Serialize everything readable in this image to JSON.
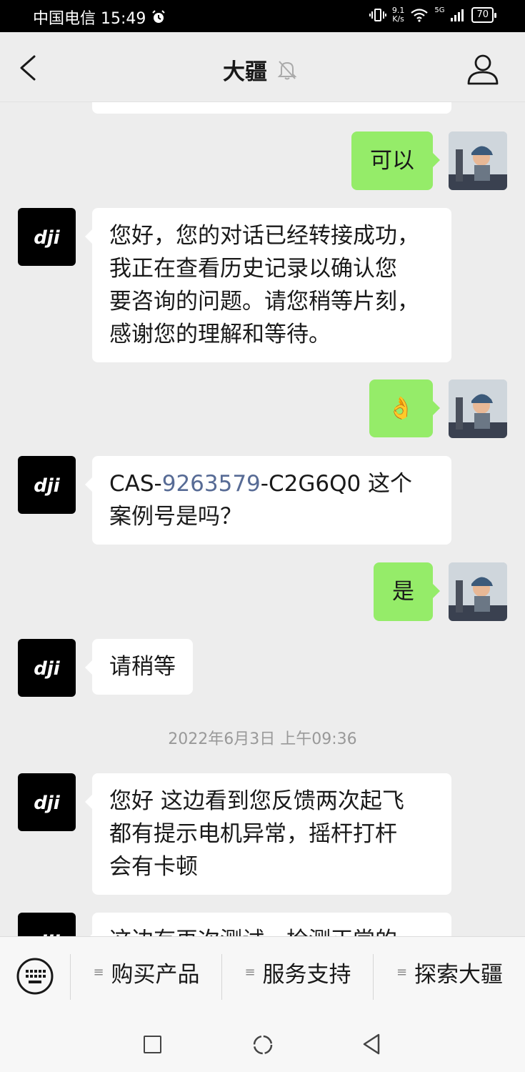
{
  "status_bar": {
    "carrier_time": "中国电信 15:49",
    "speed_value": "9.1",
    "speed_unit": "K/s",
    "network": "5G",
    "battery": "70"
  },
  "header": {
    "title": "大疆",
    "icons": [
      "back-arrow-icon",
      "mute-bell-icon",
      "person-icon"
    ]
  },
  "messages": [
    {
      "from": "me",
      "text": "可以"
    },
    {
      "from": "dji",
      "lines": [
        "您好，您的对话已经转接成功，",
        "我正在查看历史记录以确认您",
        "要咨询的问题。请您稍等片刻，",
        "感谢您的理解和等待。"
      ]
    },
    {
      "from": "me",
      "emoji": "👌"
    },
    {
      "from": "dji",
      "prefix": "CAS-",
      "link_number": "9263579",
      "suffix": "-C2G6Q0 这个",
      "line2": "案例号是吗？"
    },
    {
      "from": "me",
      "text": "是"
    },
    {
      "from": "dji",
      "text": "请稍等"
    },
    {
      "timestamp": "2022年6月3日 上午09:36"
    },
    {
      "from": "dji",
      "lines": [
        "您好 这边看到您反馈两次起飞",
        "都有提示电机异常，摇杆打杆",
        "会有卡顿"
      ]
    },
    {
      "from": "dji",
      "text": "这边有再次测试，检测正常的"
    }
  ],
  "menu": {
    "items": [
      "购买产品",
      "服务支持",
      "探索大疆"
    ]
  },
  "colors": {
    "my_bubble": "#95ec69",
    "their_bubble": "#ffffff",
    "background": "#ededed",
    "link": "#576b95"
  }
}
